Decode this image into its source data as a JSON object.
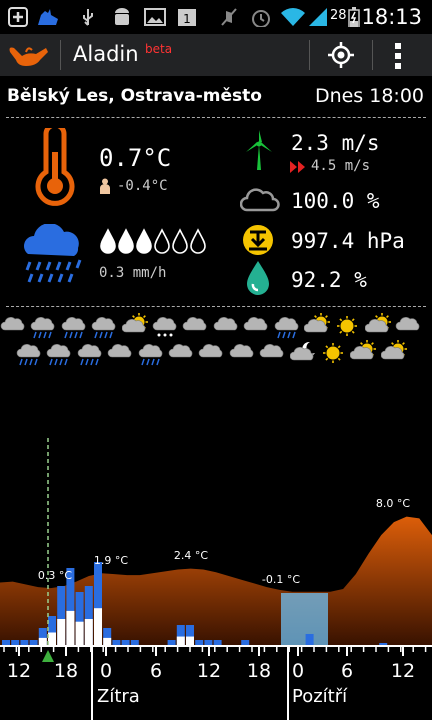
{
  "status_bar": {
    "time": "18:13",
    "battery_percent": "28",
    "icons": [
      "plus-icon",
      "app-icon",
      "usb-icon",
      "android-icon",
      "image-icon",
      "calendar-icon",
      "mute-icon",
      "alarm-icon",
      "wifi-icon",
      "signal-icon",
      "battery-icon"
    ]
  },
  "app_bar": {
    "title": "Aladin",
    "beta": "beta",
    "icons": [
      "app-logo-icon",
      "locate-icon",
      "overflow-menu-icon"
    ]
  },
  "location": {
    "place": "Bělský Les, Ostrava-město",
    "when": "Dnes 18:00"
  },
  "current": {
    "temperature": "0.7°C",
    "feels_like": "-0.4°C",
    "precipitation": "0.3 mm/h",
    "precip_drops_filled": 3,
    "precip_drops_total": 6,
    "wind_speed": "2.3 m/s",
    "wind_gust": "4.5 m/s",
    "cloudiness": "100.0 %",
    "pressure": "997.4 hPa",
    "humidity": "92.2 %"
  },
  "forecast_icons": {
    "row1": [
      "cloud",
      "cloud-rain",
      "cloud-rain",
      "cloud-rain",
      "cloud-sun",
      "cloud-snow",
      "cloud",
      "cloud",
      "cloud",
      "cloud-rain",
      "sun-cloud",
      "sun",
      "sun-cloud",
      "cloud"
    ],
    "row2": [
      "cloud-rain",
      "cloud-rain",
      "cloud-rain",
      "cloud",
      "cloud-rain",
      "cloud",
      "cloud",
      "cloud",
      "cloud",
      "moon-cloud",
      "sun",
      "sun-cloud",
      "sun-cloud"
    ]
  },
  "chart_data": {
    "type": "area",
    "temperature_labels": [
      {
        "text": "0.3 °C"
      },
      {
        "text": "1.9 °C"
      },
      {
        "text": "2.4 °C"
      },
      {
        "text": "-0.1 °C"
      },
      {
        "text": "8.0 °C"
      }
    ],
    "temperature_profile": [
      0.9,
      1.0,
      0.7,
      0.4,
      0.3,
      0.5,
      1.0,
      1.6,
      1.9,
      1.8,
      1.7,
      1.7,
      1.9,
      2.1,
      2.3,
      2.4,
      2.3,
      2.0,
      1.6,
      1.2,
      0.8,
      0.4,
      0.1,
      -0.1,
      -0.1,
      -0.1,
      -0.1,
      0.2,
      1.8,
      4.0,
      6.0,
      7.4,
      8.0,
      7.8,
      6.0
    ],
    "temp_range": [
      -4,
      10
    ],
    "precipitation_bars": [
      0.1,
      0.1,
      0.1,
      0.1,
      0.3,
      0.5,
      1.0,
      1.3,
      0.9,
      1.0,
      1.4,
      0.3,
      0.1,
      0.1,
      0.1,
      0,
      0,
      0,
      0.1,
      0.35,
      0.35,
      0.1,
      0.1,
      0.1,
      0,
      0,
      0.1,
      0,
      0,
      0,
      0,
      0,
      0,
      0.2,
      0,
      0,
      0,
      0,
      0,
      0,
      0,
      0.05,
      0,
      0,
      0,
      0,
      0
    ],
    "precip_max": 1.5,
    "x_ticks": [
      "12",
      "18",
      "0",
      "6",
      "12",
      "18",
      "0",
      "6",
      "12"
    ],
    "day_labels": [
      "Zítra",
      "Pozítří"
    ],
    "now_marker": "now",
    "colors": {
      "area": "#e8630a",
      "bar": "#2a6de0",
      "highlight": "#6ec8ff"
    }
  }
}
